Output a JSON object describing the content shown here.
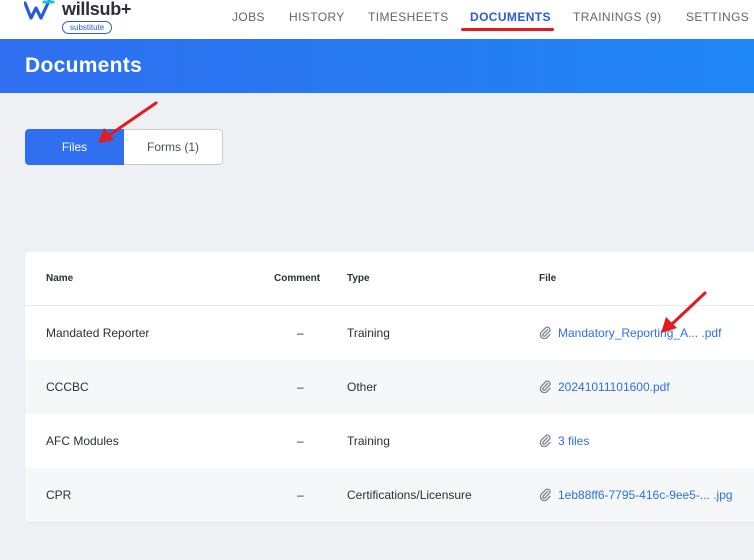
{
  "app": {
    "brand": "willsub+",
    "badge": "substitute"
  },
  "nav": {
    "items": [
      {
        "label": "JOBS"
      },
      {
        "label": "HISTORY"
      },
      {
        "label": "TIMESHEETS"
      },
      {
        "label": "DOCUMENTS",
        "active": true
      },
      {
        "label": "TRAININGS (9)"
      },
      {
        "label": "SETTINGS"
      }
    ]
  },
  "header": {
    "title": "Documents"
  },
  "tabs": {
    "files": "Files",
    "forms": "Forms (1)"
  },
  "table": {
    "columns": {
      "name": "Name",
      "comment": "Comment",
      "type": "Type",
      "file": "File"
    },
    "rows": [
      {
        "name": "Mandated Reporter",
        "comment": "–",
        "type": "Training",
        "file": "Mandatory_Reporting_A... .pdf"
      },
      {
        "name": "CCCBC",
        "comment": "–",
        "type": "Other",
        "file": "20241011101600.pdf"
      },
      {
        "name": "AFC Modules",
        "comment": "–",
        "type": "Training",
        "file": "3 files"
      },
      {
        "name": "CPR",
        "comment": "–",
        "type": "Certifications/Licensure",
        "file": "1eb88ff6-7795-416c-9ee5-... .jpg"
      }
    ]
  },
  "colors": {
    "accent": "#2f6ff0",
    "link": "#2f6fe4",
    "annotation": "#e21b1b"
  },
  "icons": {
    "logo": "willsub-logo-icon",
    "attachment": "paperclip-icon",
    "annotation": "red-arrow-icon"
  }
}
